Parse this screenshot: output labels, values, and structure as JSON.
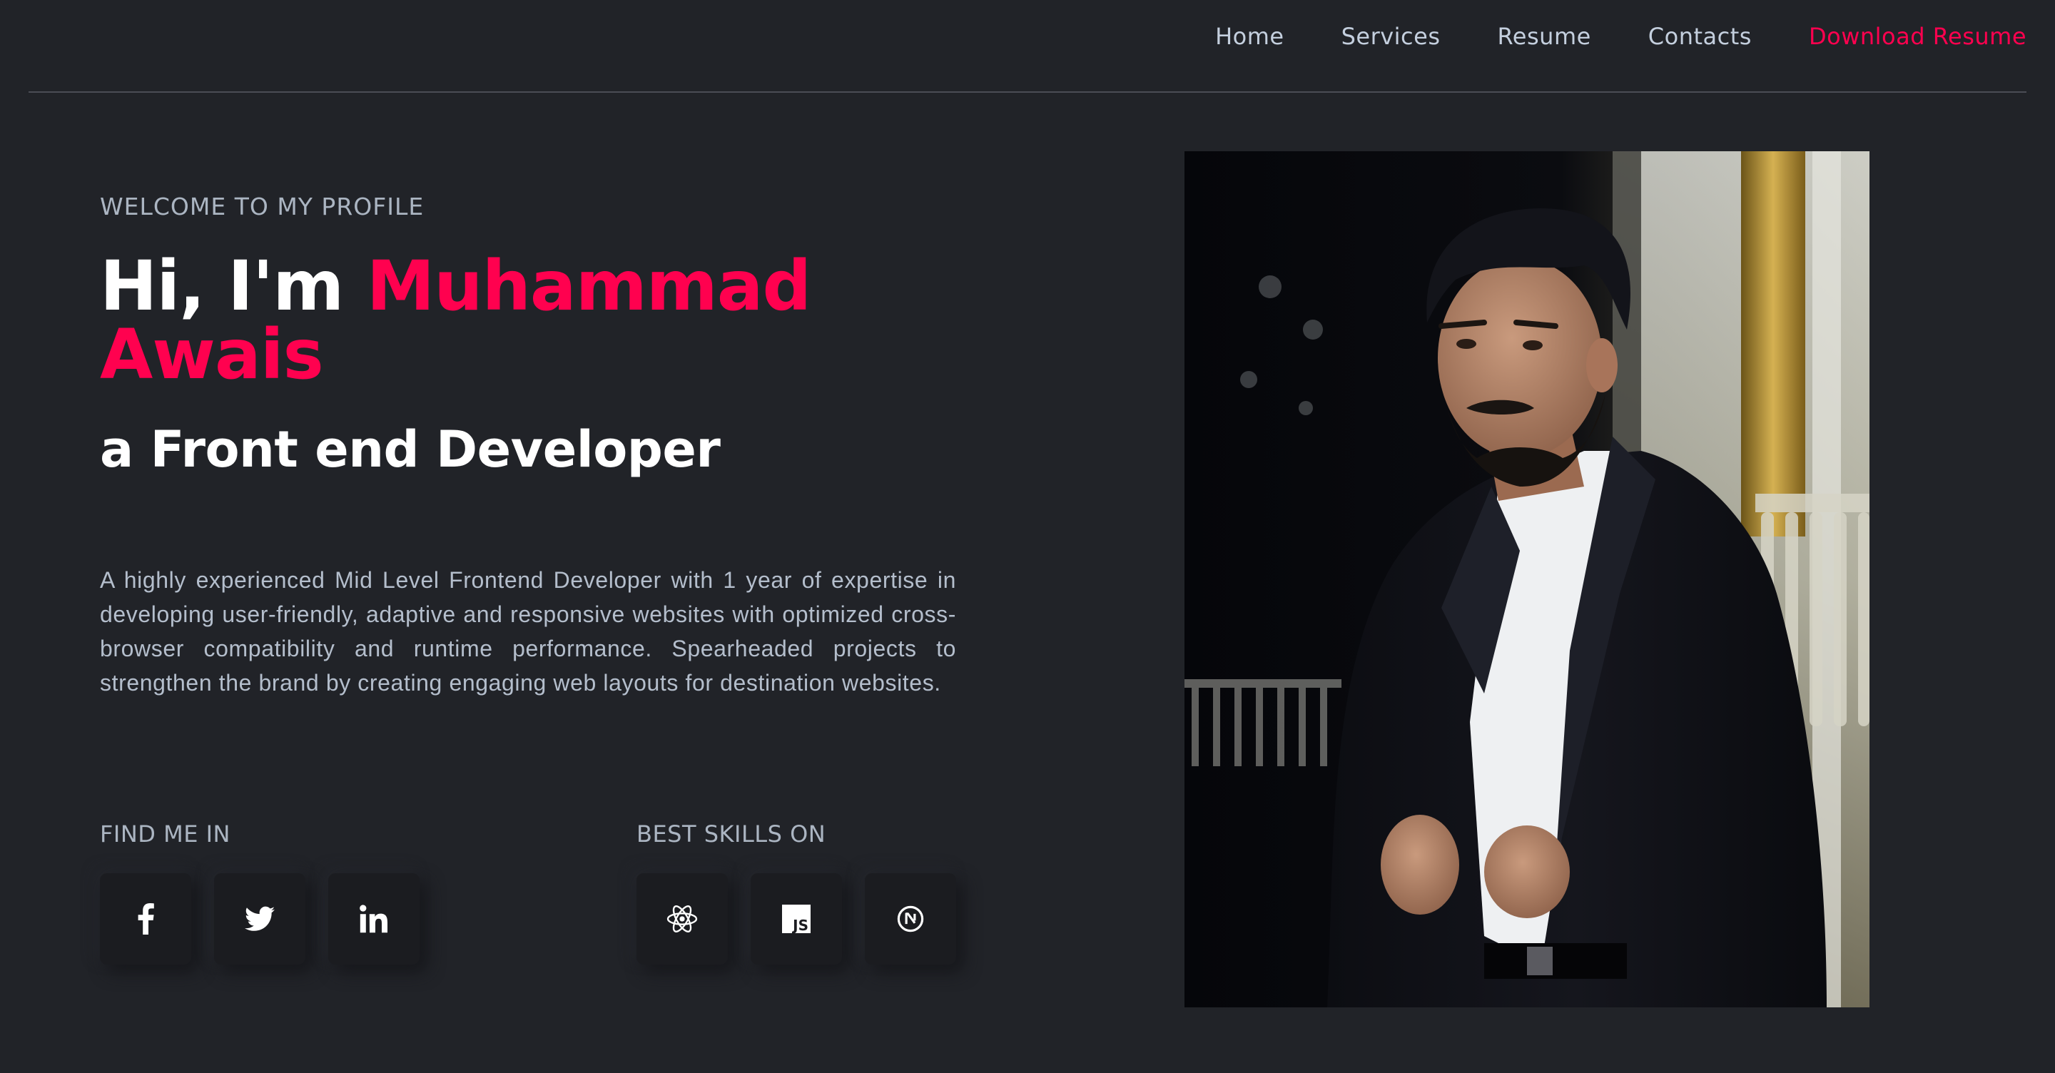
{
  "nav": {
    "links": [
      {
        "label": "Home"
      },
      {
        "label": "Services"
      },
      {
        "label": "Resume"
      },
      {
        "label": "Contacts"
      }
    ],
    "download_label": "Download Resume"
  },
  "hero": {
    "welcome": "WELCOME TO MY PROFILE",
    "greeting": "Hi, I'm ",
    "name_line1": "Muhammad",
    "name_line2": "Awais",
    "role": "a Front end Developer",
    "bio": "A highly experienced Mid Level Frontend Developer with 1 year of expertise in developing user-friendly, adaptive and responsive websites with optimized cross-browser compatibility and runtime performance. Spearheaded projects to strengthen the brand by creating engaging web layouts for destination websites."
  },
  "find_me": {
    "title": "FIND ME IN",
    "icons": [
      "facebook-icon",
      "twitter-icon",
      "linkedin-icon"
    ]
  },
  "skills": {
    "title": "BEST SKILLS ON",
    "icons": [
      "react-icon",
      "javascript-icon",
      "nextjs-icon"
    ],
    "js_badge": "JS"
  },
  "colors": {
    "background": "#212328",
    "accent": "#ff014f",
    "text": "#c4cfde",
    "heading": "#ffffff"
  }
}
